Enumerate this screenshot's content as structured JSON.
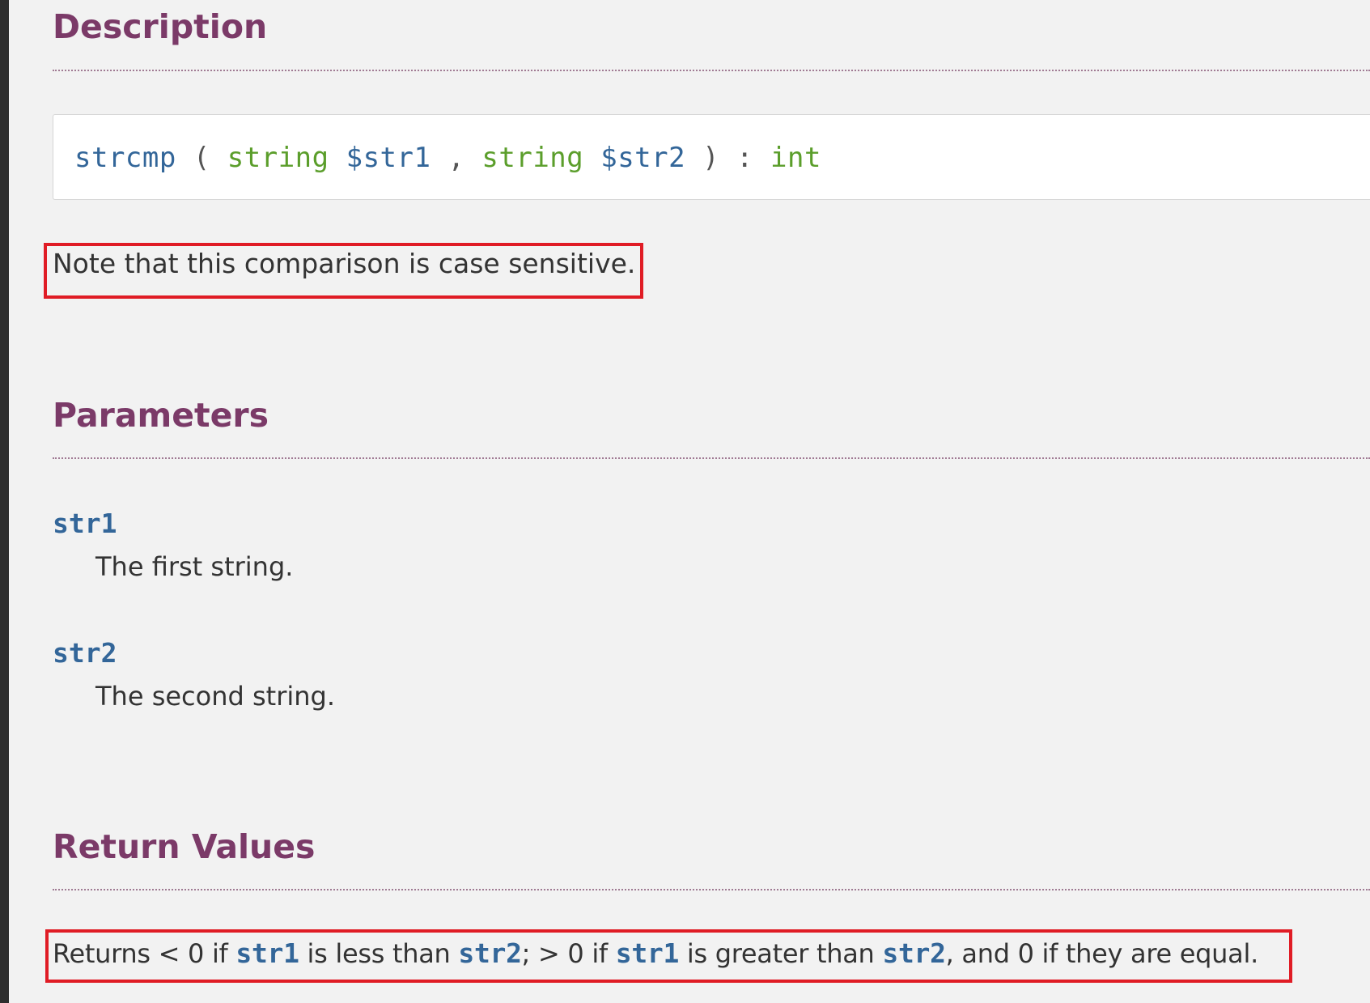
{
  "sections": {
    "description": {
      "title": "Description",
      "signature": {
        "function_name": "strcmp",
        "open_paren": "(",
        "param1_type": "string",
        "param1_var": "$str1",
        "comma": ",",
        "param2_type": "string",
        "param2_var": "$str2",
        "close_paren": ")",
        "colon": ":",
        "return_type": "int"
      },
      "note": "Note that this comparison is case sensitive."
    },
    "parameters": {
      "title": "Parameters",
      "items": [
        {
          "name": "str1",
          "description": "The first string."
        },
        {
          "name": "str2",
          "description": "The second string."
        }
      ]
    },
    "return_values": {
      "title": "Return Values",
      "parts": {
        "t1": "Returns < 0 if ",
        "c1": "str1",
        "t2": " is less than ",
        "c2": "str2",
        "t3": "; > 0 if ",
        "c3": "str1",
        "t4": " is greater than ",
        "c4": "str2",
        "t5": ", and 0 if they are equal."
      }
    }
  },
  "colors": {
    "heading": "#7b3a68",
    "code_blue": "#336699",
    "code_green": "#5b9e2b",
    "highlight_red": "#e01c25",
    "background": "#f2f2f2"
  }
}
